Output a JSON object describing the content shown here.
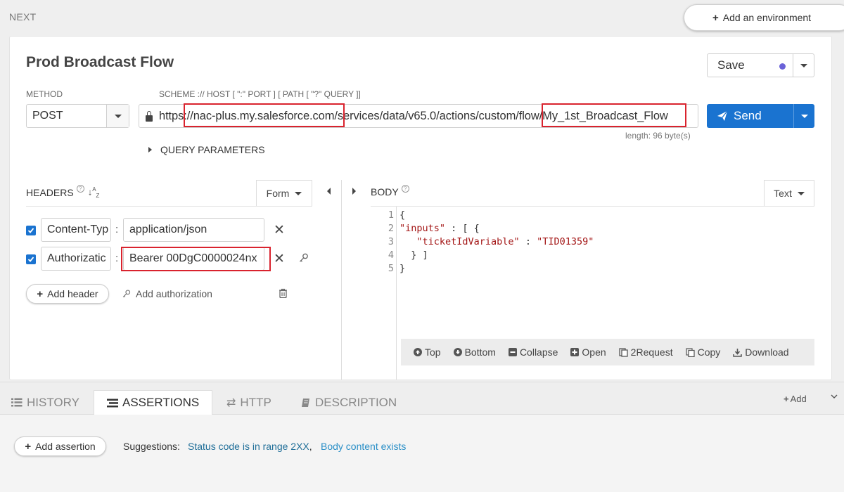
{
  "top": {
    "section_label": "NEXT",
    "add_environment": "Add an environment"
  },
  "request": {
    "title": "Prod Broadcast Flow",
    "save_label": "Save",
    "method_label": "METHOD",
    "method_value": "POST",
    "scheme_label": "SCHEME :// HOST [ \":\" PORT ] [ PATH [ \"?\" QUERY ]]",
    "url_value": "https://nac-plus.my.salesforce.com/services/data/v65.0/actions/custom/flow/My_1st_Broadcast_Flow",
    "length_text": "length: 96 byte(s)",
    "send_label": "Send",
    "query_params_label": "QUERY PARAMETERS"
  },
  "headers": {
    "label": "HEADERS",
    "mode": "Form",
    "rows": [
      {
        "name": "Content-Typ",
        "value": "application/json",
        "checked": true
      },
      {
        "name": "Authorizatic",
        "value": "Bearer 00DgC0000024nx",
        "checked": true
      }
    ],
    "add_header": "Add header",
    "add_authorization": "Add authorization"
  },
  "body": {
    "label": "BODY",
    "mode": "Text",
    "line_numbers": [
      "1",
      "2",
      "3",
      "4",
      "5"
    ],
    "toolbar": [
      "Top",
      "Bottom",
      "Collapse",
      "Open",
      "2Request",
      "Copy",
      "Download"
    ]
  },
  "bottom_tabs": [
    "HISTORY",
    "ASSERTIONS",
    "HTTP",
    "DESCRIPTION"
  ],
  "bottom": {
    "add_label": "Add",
    "add_assertion": "Add assertion",
    "suggestions_label": "Suggestions:",
    "suggestion_1": "Status code is in range 2XX",
    "suggestion_2": "Body content exists"
  },
  "colors": {
    "accent": "#1a73d0",
    "highlight": "#d9232e",
    "status_dot": "#6a62d8"
  }
}
